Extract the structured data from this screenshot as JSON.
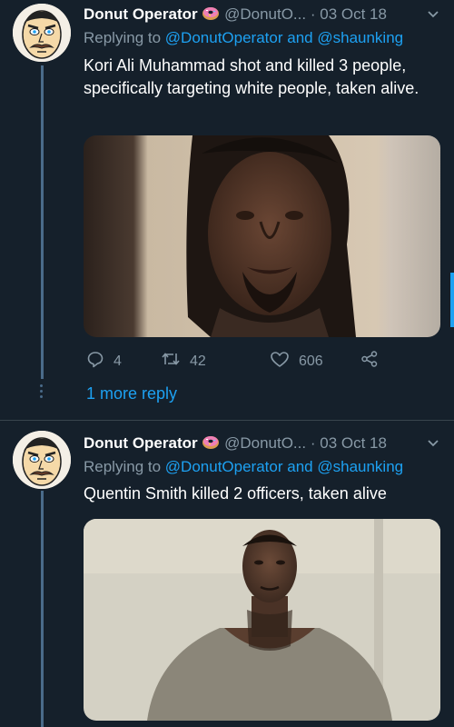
{
  "tweets": [
    {
      "author_name": "Donut Operator",
      "handle": "@DonutO...",
      "separator": "·",
      "date": "03 Oct 18",
      "replying_prefix": "Replying to",
      "replying_user1": "@DonutOperator",
      "replying_and": "and",
      "replying_user2": "@shaunking",
      "text": "Kori Ali Muhammad shot and killed 3 people, specifically targeting white people, taken alive.",
      "replies": "4",
      "retweets": "42",
      "likes": "606"
    },
    {
      "author_name": "Donut Operator",
      "handle": "@DonutO...",
      "separator": "·",
      "date": "03 Oct 18",
      "replying_prefix": "Replying to",
      "replying_user1": "@DonutOperator",
      "replying_and": "and",
      "replying_user2": "@shaunking",
      "text": "Quentin Smith killed 2 officers, taken alive"
    }
  ],
  "more_reply_label": "1 more reply",
  "icons": [
    "chevron-down-icon",
    "reply-icon",
    "retweet-icon",
    "like-icon",
    "share-icon",
    "donut-icon"
  ],
  "colors": {
    "background": "#15202b",
    "accent": "#1da1f2",
    "muted": "#8899a6",
    "divider": "#38444d"
  }
}
